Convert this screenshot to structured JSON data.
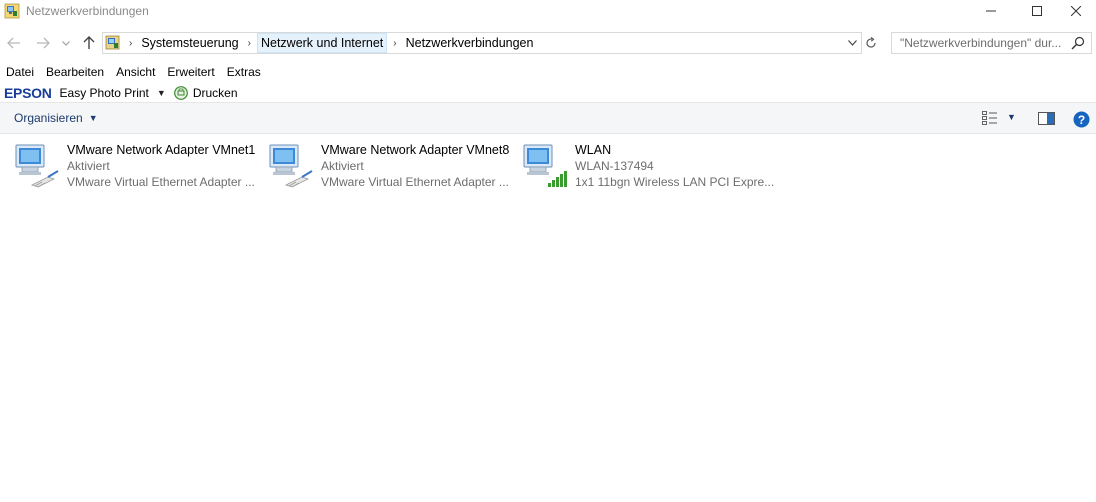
{
  "window": {
    "title": "Netzwerkverbindungen",
    "minimize_icon": "minimize-icon",
    "maximize_icon": "maximize-icon",
    "close_icon": "close-icon"
  },
  "address": {
    "crumbs": [
      "Systemsteuerung",
      "Netzwerk und Internet",
      "Netzwerkverbindungen"
    ],
    "search_placeholder": "\"Netzwerkverbindungen\" dur..."
  },
  "menu": {
    "items": [
      "Datei",
      "Bearbeiten",
      "Ansicht",
      "Erweitert",
      "Extras"
    ]
  },
  "epson": {
    "logo": "EPSON",
    "easy_photo_print": "Easy Photo Print",
    "print": "Drucken"
  },
  "commandbar": {
    "organize": "Organisieren"
  },
  "connections": [
    {
      "name": "VMware Network Adapter VMnet1",
      "status": "Aktiviert",
      "device": "VMware Virtual Ethernet Adapter ..."
    },
    {
      "name": "VMware Network Adapter VMnet8",
      "status": "Aktiviert",
      "device": "VMware Virtual Ethernet Adapter ..."
    },
    {
      "name": "WLAN",
      "status": "WLAN-137494",
      "device": "1x1 11bgn Wireless LAN PCI Expre..."
    }
  ],
  "colors": {
    "accent": "#1e3a6e",
    "epson_blue": "#1a3d9a",
    "signal_green": "#3a9b2f",
    "help_blue": "#1565c0"
  }
}
